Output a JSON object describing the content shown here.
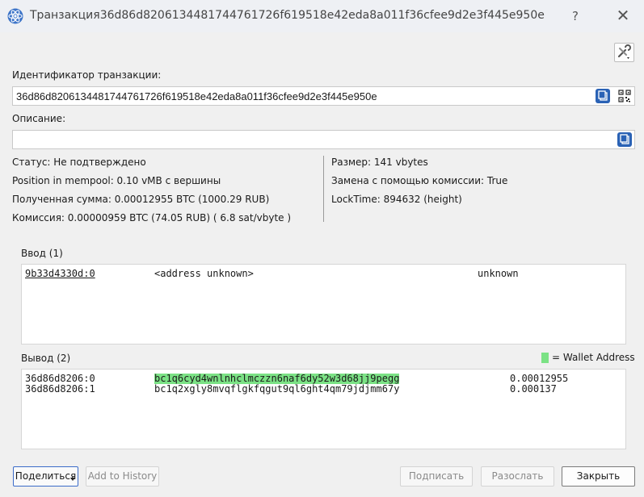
{
  "window": {
    "title": "Транзакция 36d86d82061344817447617 26f619518e42eda8a011f36cfee9d2e3f445e950e",
    "help_label": "?",
    "close_label": "✕"
  },
  "tx": {
    "id_label": "Идентификатор транзакции:",
    "id_value": "36d86d820613448174476172 6f619518e42eda8a011f36cfee9d2e3f445e950e",
    "desc_label": "Описание:",
    "desc_value": ""
  },
  "info": {
    "left": [
      "Статус: Не подтверждено",
      "Position in mempool: 0.10 vMB с вершины",
      "Полученная сумма: 0.00012955 BTC (1000.29 RUB)",
      "Комиссия: 0.00000959 BTC (74.05 RUB)  ( 6.8 sat/vbyte )"
    ],
    "right": [
      "Размер: 141 vbytes",
      "Замена с помощью комиссии: True",
      "LockTime: 894632 (height)"
    ]
  },
  "inputs": {
    "label": "Ввод (1)",
    "rows": [
      {
        "ref": "9b33d4330d:0",
        "address": "<address unknown>",
        "amount": "unknown"
      }
    ]
  },
  "outputs": {
    "label": "Вывод (2)",
    "legend": "= Wallet Address",
    "wallet_color": "#7be285",
    "rows": [
      {
        "ref": "36d86d8206:0",
        "address": "bc1q6cyd4wnlnhclmczzn6naf6dy52w3d68jj9pegg",
        "amount": "0.00012955",
        "is_wallet": true
      },
      {
        "ref": "36d86d8206:1",
        "address": "bc1q2xgly8mvqflgkfqgut9ql6ght4qm79jdjmm67y",
        "amount": "0.000137",
        "is_wallet": false
      }
    ]
  },
  "buttons": {
    "share": "Поделиться",
    "add_history": "Add to History",
    "sign": "Подписать",
    "broadcast": "Разослать",
    "close": "Закрыть"
  },
  "icons": {
    "app": "electrum-logo-icon",
    "tools": "tools-icon",
    "copy": "copy-icon",
    "qr": "qr-code-icon"
  },
  "colors": {
    "accent": "#2a62b5",
    "highlight": "#7be285"
  }
}
